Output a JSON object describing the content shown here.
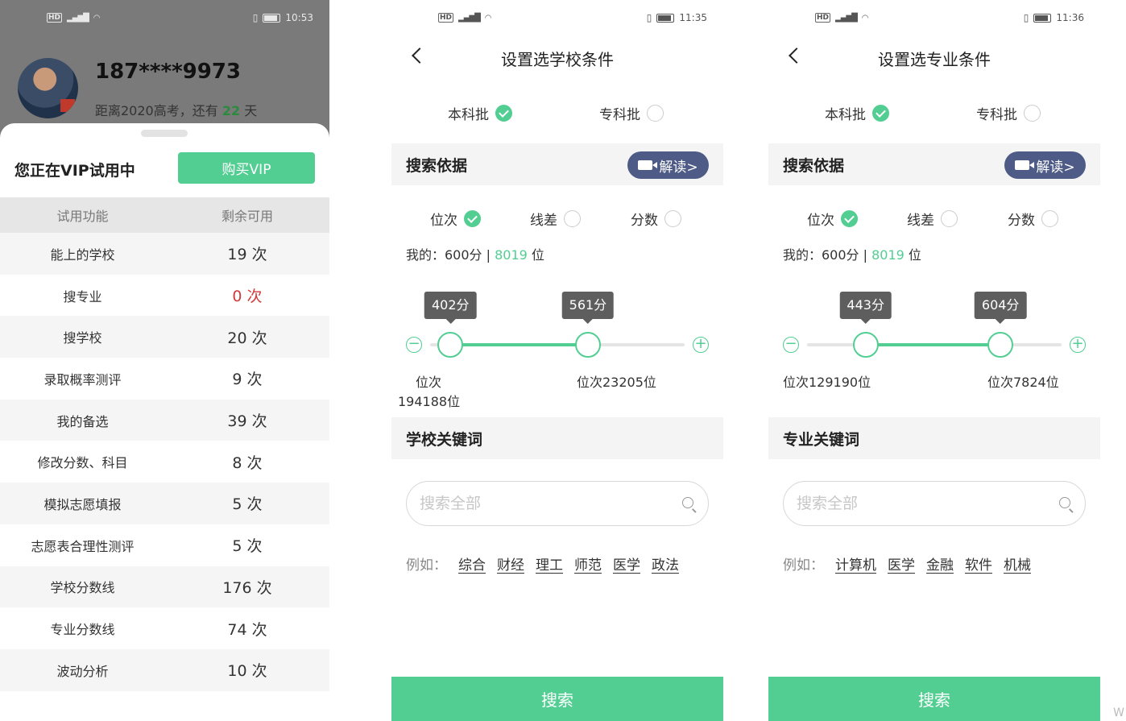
{
  "screens": [
    {
      "status": {
        "time": "10:53"
      },
      "profile": {
        "phone": "187****9973",
        "countdown_prefix": "距离2020高考，还有",
        "countdown_days": "22",
        "countdown_suffix": "天"
      },
      "vip": {
        "title": "您正在VIP试用中",
        "buy_label": "购买VIP"
      },
      "table": {
        "headers": [
          "试用功能",
          "剩余可用"
        ],
        "rows": [
          {
            "feature": "能上的学校",
            "remaining": "19 次"
          },
          {
            "feature": "搜专业",
            "remaining": "0 次"
          },
          {
            "feature": "搜学校",
            "remaining": "20 次"
          },
          {
            "feature": "录取概率测评",
            "remaining": "9 次"
          },
          {
            "feature": "我的备选",
            "remaining": "39 次"
          },
          {
            "feature": "修改分数、科目",
            "remaining": "8 次"
          },
          {
            "feature": "模拟志愿填报",
            "remaining": "5 次"
          },
          {
            "feature": "志愿表合理性测评",
            "remaining": "5 次"
          },
          {
            "feature": "学校分数线",
            "remaining": "176 次"
          },
          {
            "feature": "专业分数线",
            "remaining": "74 次"
          },
          {
            "feature": "波动分析",
            "remaining": "10 次"
          }
        ]
      }
    },
    {
      "status": {
        "time": "11:35"
      },
      "title": "设置选学校条件",
      "batch": {
        "options": [
          "本科批",
          "专科批"
        ],
        "selected": "本科批"
      },
      "basis": {
        "title": "搜索依据",
        "explain_label": "解读>",
        "options": [
          "位次",
          "线差",
          "分数"
        ],
        "selected": "位次"
      },
      "mine": {
        "prefix": "我的：600分 | ",
        "rank": "8019",
        "suffix": " 位"
      },
      "slider": {
        "low_tip": "402分",
        "high_tip": "561分",
        "low_label": "位次\n194188位",
        "high_label": "位次23205位",
        "low_fraction": 0.08,
        "high_fraction": 0.62
      },
      "keyword": {
        "title": "学校关键词",
        "placeholder": "搜索全部",
        "example_label": "例如：",
        "examples": [
          "综合",
          "财经",
          "理工",
          "师范",
          "医学",
          "政法"
        ]
      },
      "search_label": "搜索"
    },
    {
      "status": {
        "time": "11:36"
      },
      "title": "设置选专业条件",
      "batch": {
        "options": [
          "本科批",
          "专科批"
        ],
        "selected": "本科批"
      },
      "basis": {
        "title": "搜索依据",
        "explain_label": "解读>",
        "options": [
          "位次",
          "线差",
          "分数"
        ],
        "selected": "位次"
      },
      "mine": {
        "prefix": "我的：600分 | ",
        "rank": "8019",
        "suffix": " 位"
      },
      "slider": {
        "low_tip": "443分",
        "high_tip": "604分",
        "low_label": "位次129190位",
        "high_label": "位次7824位",
        "low_fraction": 0.23,
        "high_fraction": 0.76
      },
      "keyword": {
        "title": "专业关键词",
        "placeholder": "搜索全部",
        "example_label": "例如：",
        "examples": [
          "计算机",
          "医学",
          "金融",
          "软件",
          "机械"
        ]
      },
      "search_label": "搜索"
    }
  ],
  "colors": {
    "accent": "#52ce93",
    "explain_bg": "#4d5b86",
    "zero_red": "#d23a3a"
  },
  "watermark": "W"
}
